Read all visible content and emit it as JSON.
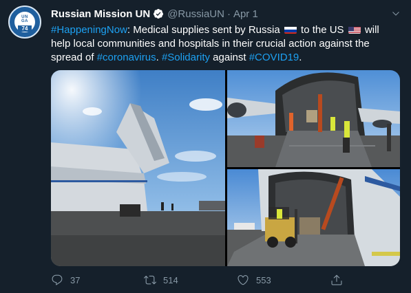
{
  "account": {
    "name": "Russian Mission UN",
    "handle": "@RussiaUN",
    "separator": "·",
    "date": "Apr 1",
    "avatar_lines": [
      "UN",
      "GA",
      "74"
    ]
  },
  "tweet": {
    "hashtag_happening": "#HappeningNow",
    "text_1": ": Medical supplies sent by Russia ",
    "text_2": " to the US ",
    "text_3": " will help local communities and hospitals in their crucial action against the spread of ",
    "hashtag_coronavirus": "#coronavirus",
    "text_4": ". ",
    "hashtag_solidarity": "#Solidarity",
    "text_5": " against ",
    "hashtag_covid": "#COVID19",
    "text_6": "."
  },
  "actions": {
    "replies": "37",
    "retweets": "514",
    "likes": "553"
  },
  "colors": {
    "background": "#15202b",
    "link": "#1da1f2",
    "muted": "#8899a6",
    "avatar_blue": "#1f5f9e"
  },
  "icons": {
    "verified": "verified-badge-icon",
    "caret": "chevron-down-icon",
    "reply": "reply-icon",
    "retweet": "retweet-icon",
    "like": "heart-icon",
    "share": "share-icon",
    "flag_russia": "russia-flag-icon",
    "flag_us": "us-flag-icon"
  }
}
